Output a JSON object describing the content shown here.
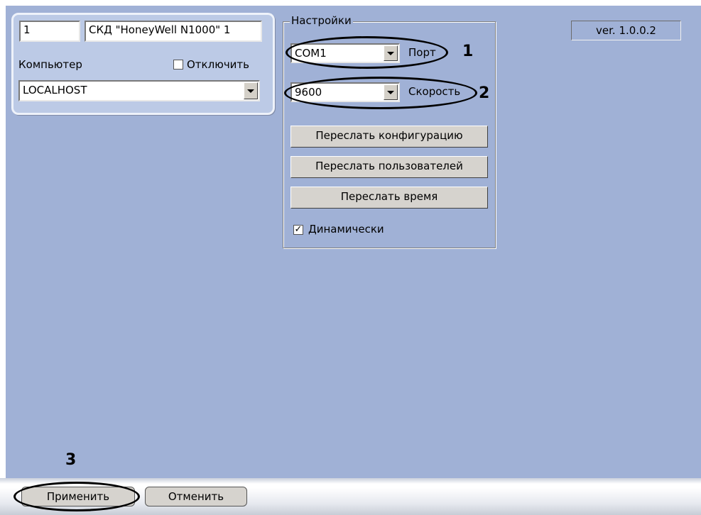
{
  "device_panel": {
    "id_value": "1",
    "name_value": "СКД \"HoneyWell N1000\" 1",
    "computer_label": "Компьютер",
    "disable_label": "Отключить",
    "disable_checked": false,
    "computer_value": "LOCALHOST"
  },
  "settings": {
    "group_title": "Настройки",
    "port_value": "COM1",
    "port_label": "Порт",
    "speed_value": "9600",
    "speed_label": "Скорость",
    "send_config_button": "Переслать конфигурацию",
    "send_users_button": "Переслать пользователей",
    "send_time_button": "Переслать время",
    "dynamic_label": "Динамически",
    "dynamic_checked": true
  },
  "version": "ver. 1.0.0.2",
  "annotations": {
    "one": "1",
    "two": "2",
    "three": "3"
  },
  "footer": {
    "apply_button": "Применить",
    "cancel_button": "Отменить"
  },
  "colors": {
    "background": "#a0b1d6",
    "panel": "#bccae6",
    "button_face": "#d6d3ce"
  }
}
